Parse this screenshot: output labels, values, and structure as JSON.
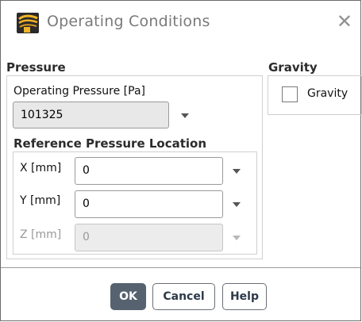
{
  "dialog": {
    "title": "Operating Conditions",
    "close_icon": "close-icon",
    "app_icon": "fluent-app-icon"
  },
  "pressure": {
    "section_label": "Pressure",
    "operating_pressure_label": "Operating Pressure [Pa]",
    "operating_pressure_value": "101325",
    "reference_location_label": "Reference Pressure Location",
    "x_label": "X [mm]",
    "x_value": "0",
    "y_label": "Y [mm]",
    "y_value": "0",
    "z_label": "Z [mm]",
    "z_value": "0"
  },
  "gravity": {
    "section_label": "Gravity",
    "checkbox_label": "Gravity",
    "checked": false
  },
  "buttons": {
    "ok": "OK",
    "cancel": "Cancel",
    "help": "Help"
  },
  "colors": {
    "primary_button": "#566270",
    "border": "#9a9a9a",
    "title_text": "#7a7a7a"
  }
}
